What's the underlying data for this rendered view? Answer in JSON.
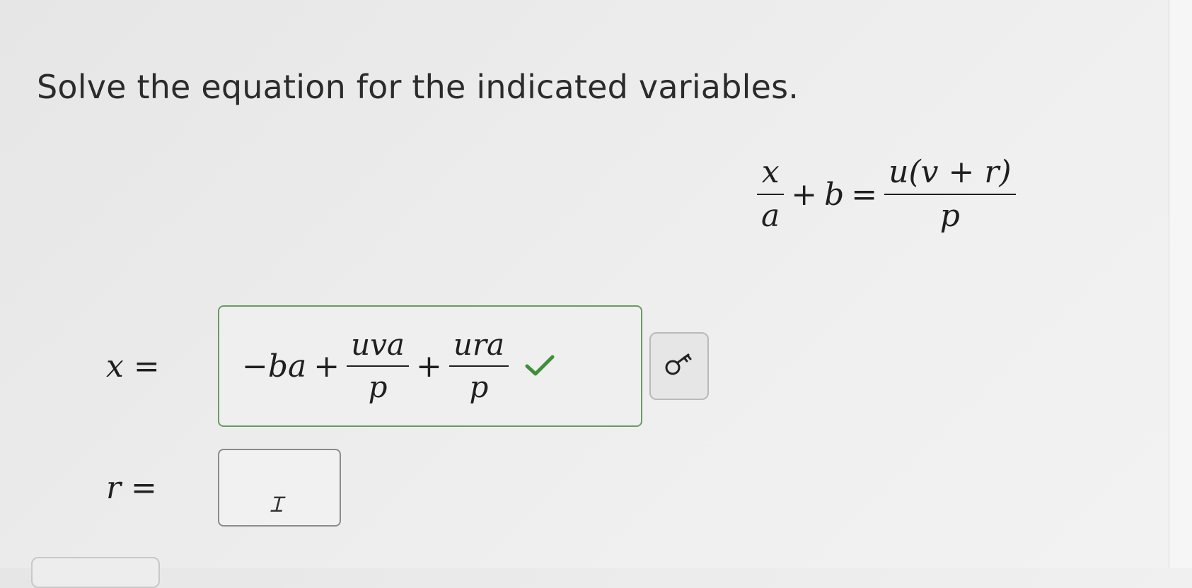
{
  "instruction": "Solve the equation for the indicated variables.",
  "equation": {
    "lhs_num": "x",
    "lhs_den": "a",
    "plus": "+",
    "b": "b",
    "equals": "=",
    "rhs_num": "u(v + r)",
    "rhs_den": "p"
  },
  "answer_x": {
    "label": "x",
    "equals": "=",
    "term1": "−ba",
    "plus1": "+",
    "frac1_num": "uva",
    "frac1_den": "p",
    "plus2": "+",
    "frac2_num": "ura",
    "frac2_den": "p",
    "status": "correct"
  },
  "answer_r": {
    "label": "r",
    "equals": "=",
    "value": ""
  },
  "icons": {
    "check": "check-icon",
    "key": "key-icon",
    "cursor": "text-cursor-icon"
  },
  "colors": {
    "correct_border": "#6a9a66",
    "check": "#3f8f3a"
  }
}
